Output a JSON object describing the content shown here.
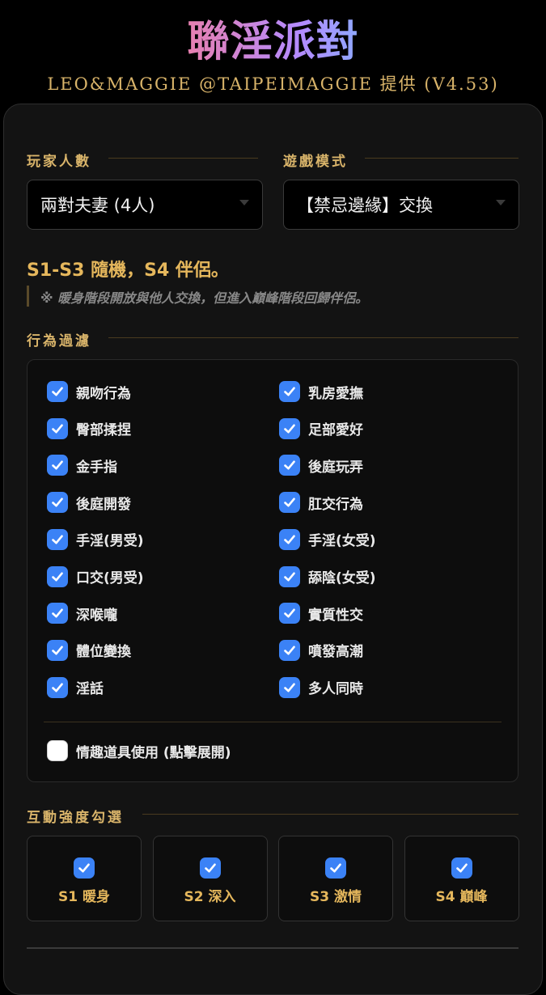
{
  "app": {
    "title": "聯淫派對",
    "credit": "LEO&MAGGIE @TAIPEIMAGGIE 提供 (V4.53)"
  },
  "settings": {
    "players_label": "玩家人數",
    "players_value": "兩對夫妻 (4人)",
    "mode_label": "遊戲模式",
    "mode_value": "【禁忌邊緣】交換"
  },
  "mode_info": {
    "title": "S1-S3 隨機，S4 伴侶。",
    "note": "※ 暖身階段開放與他人交換，但進入巔峰階段回歸伴侶。"
  },
  "filter": {
    "label": "行為過濾",
    "items": [
      {
        "label": "親吻行為",
        "checked": true
      },
      {
        "label": "乳房愛撫",
        "checked": true
      },
      {
        "label": "臀部揉捏",
        "checked": true
      },
      {
        "label": "足部愛好",
        "checked": true
      },
      {
        "label": "金手指",
        "checked": true
      },
      {
        "label": "後庭玩弄",
        "checked": true
      },
      {
        "label": "後庭開發",
        "checked": true
      },
      {
        "label": "肛交行為",
        "checked": true
      },
      {
        "label": "手淫(男受)",
        "checked": true
      },
      {
        "label": "手淫(女受)",
        "checked": true
      },
      {
        "label": "口交(男受)",
        "checked": true
      },
      {
        "label": "舔陰(女受)",
        "checked": true
      },
      {
        "label": "深喉嚨",
        "checked": true
      },
      {
        "label": "實質性交",
        "checked": true
      },
      {
        "label": "體位變換",
        "checked": true
      },
      {
        "label": "噴發高潮",
        "checked": true
      },
      {
        "label": "淫話",
        "checked": true
      },
      {
        "label": "多人同時",
        "checked": true
      }
    ],
    "toys": {
      "label": "情趣道具使用 (點擊展開)",
      "checked": false
    }
  },
  "intensity": {
    "label": "互動強度勾選",
    "stages": [
      {
        "label": "S1 暖身",
        "checked": true
      },
      {
        "label": "S2 深入",
        "checked": true
      },
      {
        "label": "S3 激情",
        "checked": true
      },
      {
        "label": "S4 巔峰",
        "checked": true
      }
    ]
  },
  "colors": {
    "accent": "#d9b46a",
    "checkbox": "#3b82f6",
    "background": "#000000"
  }
}
